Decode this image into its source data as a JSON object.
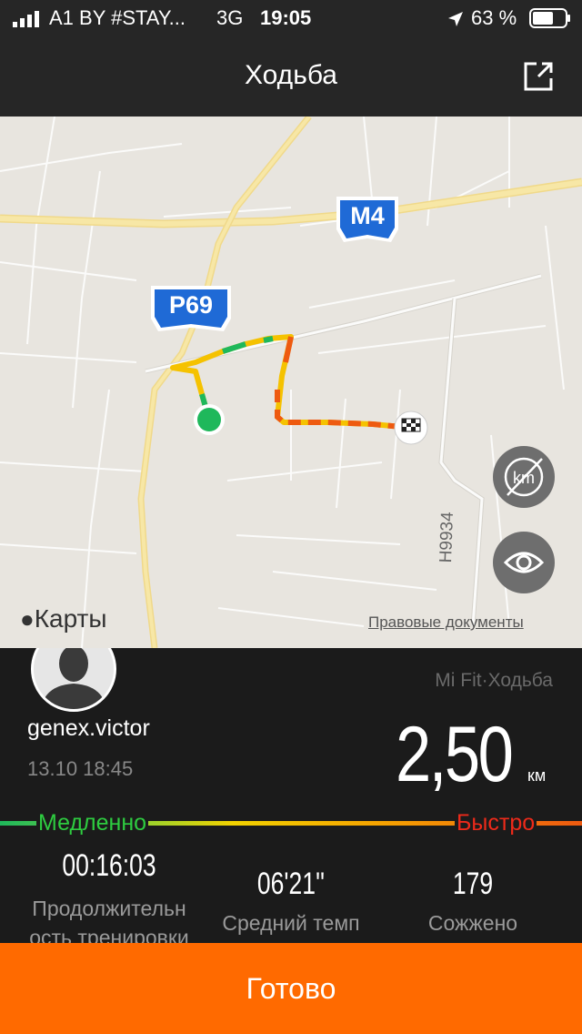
{
  "status_bar": {
    "carrier": "A1 BY #STAY...",
    "network": "3G",
    "time": "19:05",
    "battery": "63 %"
  },
  "header": {
    "title": "Ходьба",
    "share_icon": "share-icon"
  },
  "map": {
    "road_labels": [
      "M4",
      "P69",
      "H9934"
    ],
    "provider": "Карты",
    "legal_link": "Правовые документы",
    "km_toggle_icon": "km-hidden-icon",
    "visibility_icon": "eye-icon"
  },
  "workout": {
    "username": "genex.victor",
    "datetime": "13.10 18:45",
    "source": "Mi Fit·Ходьба",
    "distance": "2,50",
    "distance_unit": "км",
    "speed_slow": "Медленно",
    "speed_fast": "Быстро",
    "stats": [
      {
        "value": "00:16:03",
        "label_line1": "Продолжительн",
        "label_line2": "ость тренировки"
      },
      {
        "value": "06'21''",
        "label_line1": "Средний темп"
      },
      {
        "value": "179",
        "label_line1": "Сожжено"
      }
    ]
  },
  "footer": {
    "done_label": "Готово"
  },
  "colors": {
    "accent": "#ff6a00",
    "route_start": "#1fb85b",
    "slow": "#2ecc40",
    "fast": "#ee2a1a"
  }
}
